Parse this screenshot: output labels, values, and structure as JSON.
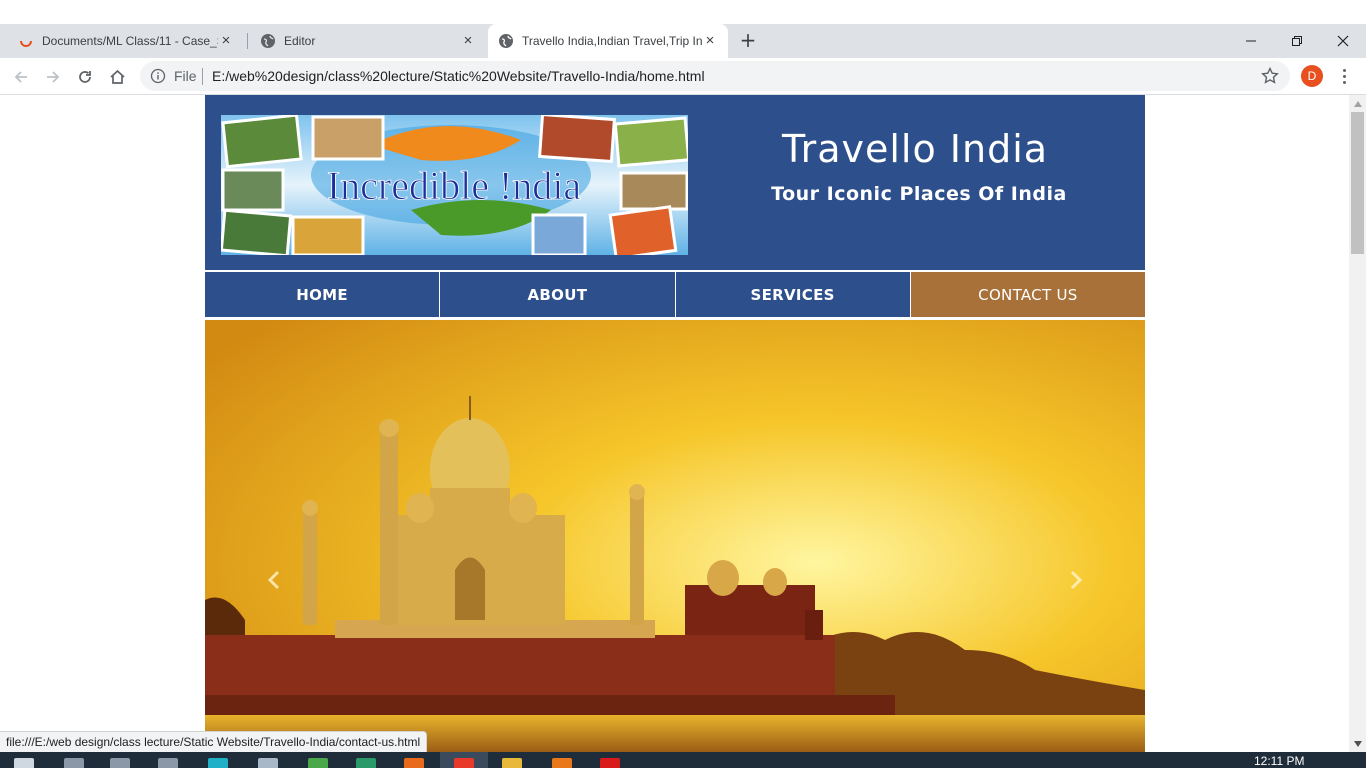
{
  "browser": {
    "tabs": [
      {
        "title": "Documents/ML Class/11 - Case_S",
        "icon": "loading-spinner-icon"
      },
      {
        "title": "Editor",
        "icon": "globe-icon"
      },
      {
        "title": "Travello India,Indian Travel,Trip In",
        "icon": "globe-icon",
        "active": true
      }
    ],
    "new_tab_label": "+",
    "address": {
      "scheme_label": "File",
      "url": "E:/web%20design/class%20lecture/Static%20Website/Travello-India/home.html"
    },
    "profile_initial": "D",
    "status_url": "file:///E:/web design/class lecture/Static Website/Travello-India/contact-us.html"
  },
  "site": {
    "banner_text": "Incredible !ndia",
    "title": "Travello India",
    "tagline": "Tour Iconic Places Of India",
    "nav": [
      "HOME",
      "ABOUT",
      "SERVICES",
      "CONTACT US"
    ],
    "colors": {
      "header": "#2d4f8b",
      "nav": "#2d4f8b",
      "nav_active": "#a9713a"
    }
  },
  "taskbar": {
    "clock": "12:11 PM"
  }
}
